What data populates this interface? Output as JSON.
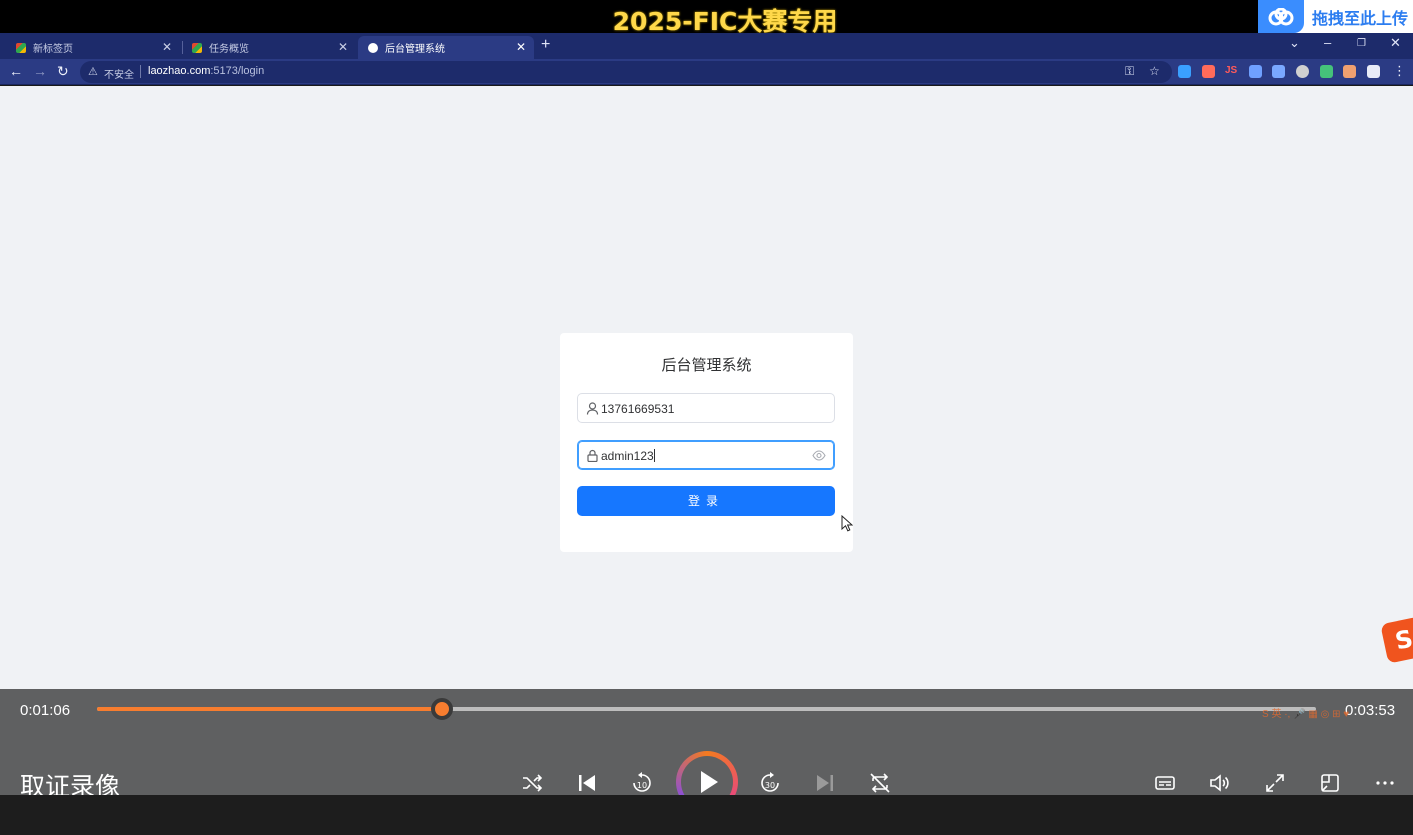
{
  "banner": {
    "title": "2025-FIC大赛专用",
    "upload_label": "拖拽至此上传"
  },
  "browser": {
    "tabs": [
      {
        "label": "新标签页",
        "active": false
      },
      {
        "label": "任务概览",
        "active": false
      },
      {
        "label": "后台管理系统",
        "active": true
      }
    ],
    "security_label": "不安全",
    "url_host": "laozhao.com",
    "url_path": ":5173/login"
  },
  "login": {
    "title": "后台管理系统",
    "username_value": "13761669531",
    "password_value": "admin123",
    "submit_label": "登录"
  },
  "player": {
    "current_time": "0:01:06",
    "total_time": "0:03:53",
    "progress": 0.283,
    "title": "取证录像"
  },
  "colors": {
    "accent": "#1677ff",
    "progress": "#f77d2f",
    "chrome": "#2b3b84"
  }
}
